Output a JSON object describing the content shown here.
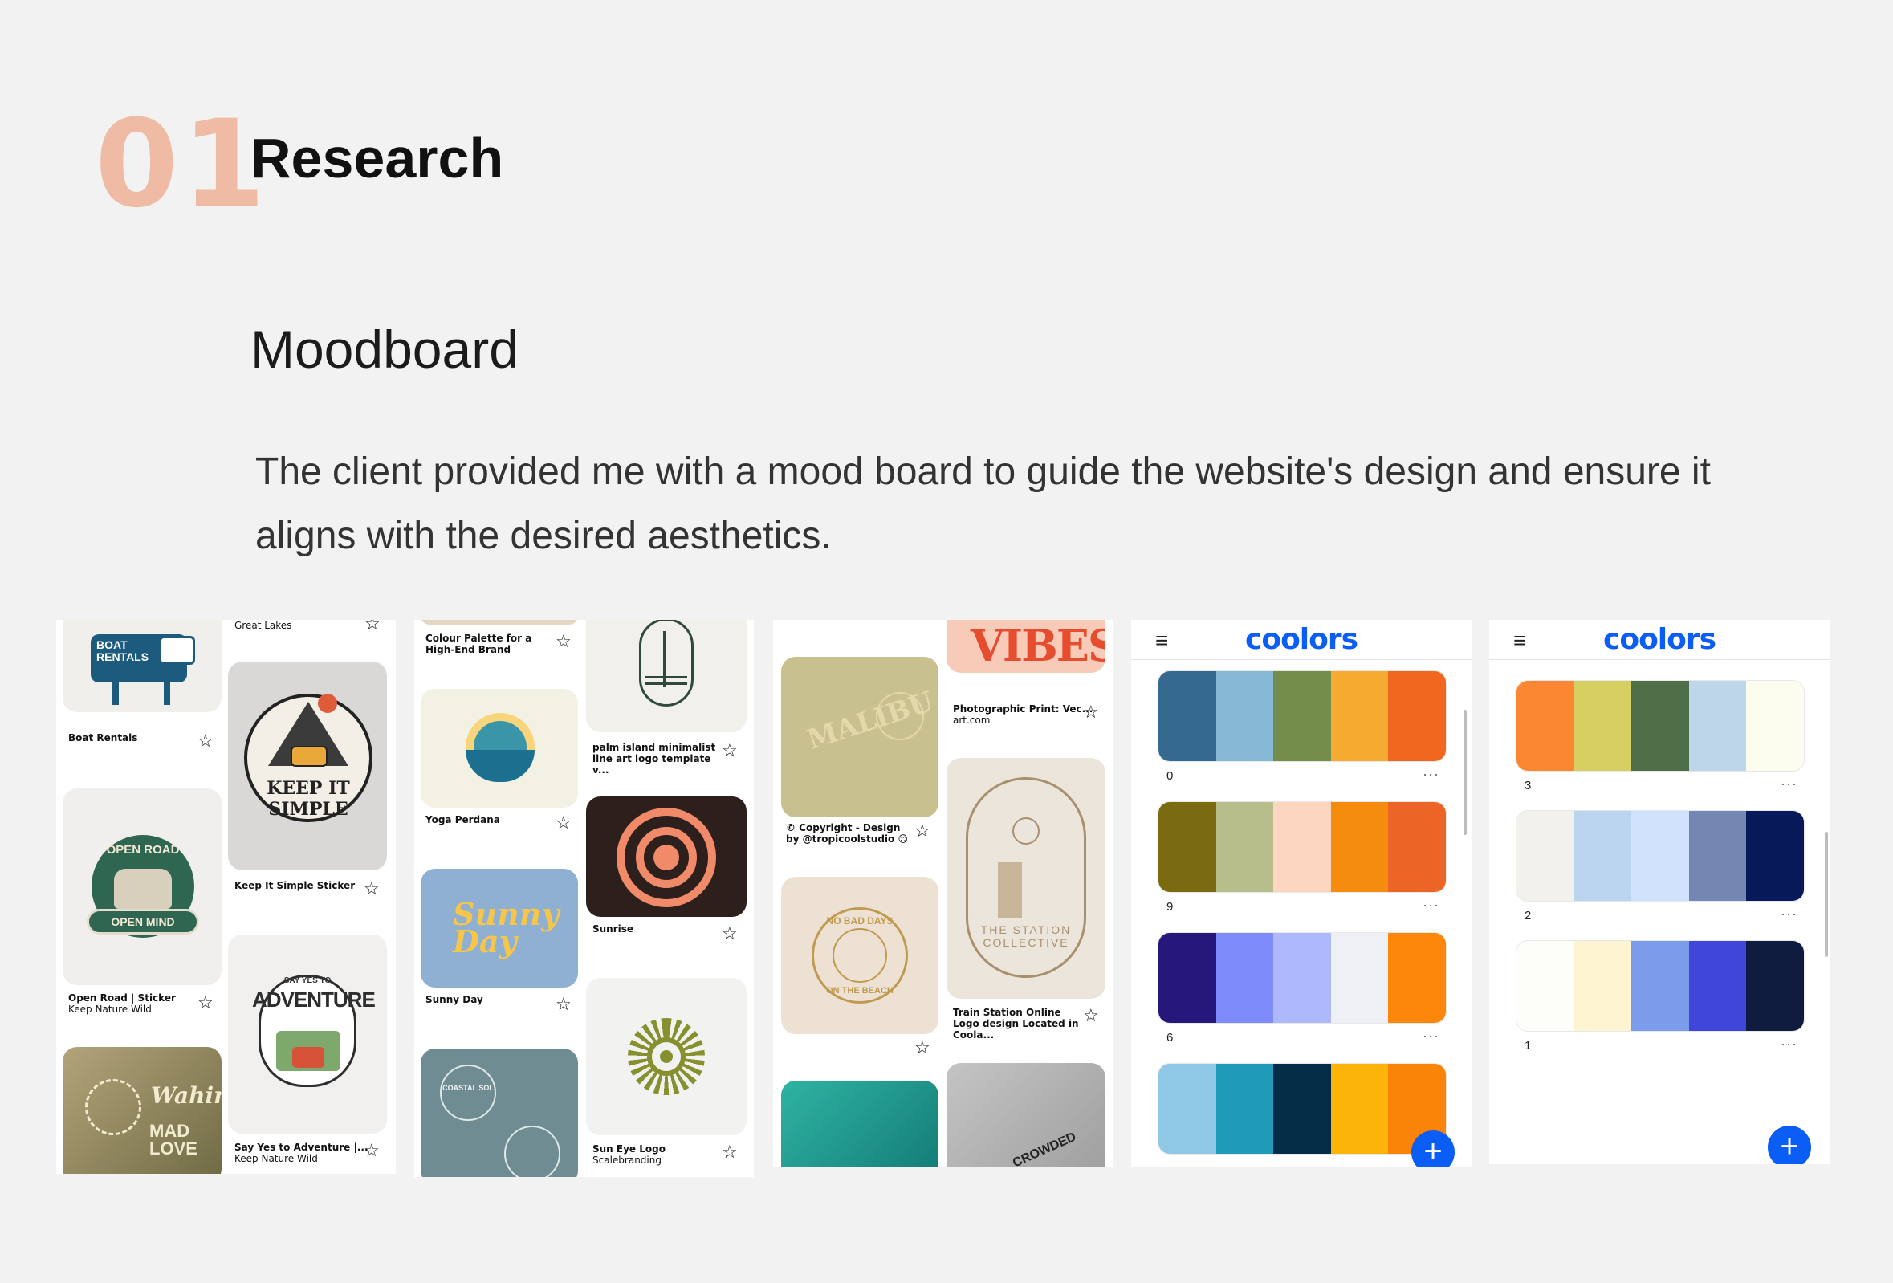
{
  "heading": {
    "number": "01",
    "title": "Research"
  },
  "subheading": "Moodboard",
  "description": "The client provided me with a mood board to guide the website's design and ensure it aligns with the desired aesthetics.",
  "panel1": {
    "top_caption": "Great Lakes",
    "boat_sign_1": "BOAT",
    "boat_sign_2": "RENTALS",
    "c1": "Boat Rentals",
    "c2": "Keep It Simple Sticker",
    "keep_text": "KEEP IT SIMPLE",
    "c3_title": "Open Road | Sticker",
    "c3_sub": "Keep Nature Wild",
    "open_road_top": "OPEN ROAD",
    "open_road_bottom": "OPEN MIND",
    "say_yes": "SAY YES TO",
    "adventure": "ADVENTURE",
    "c4_title": "Say Yes to Adventure |...",
    "c4_sub": "Keep Nature Wild",
    "wahine": "Wahine",
    "mad_love": "MAD LOVE"
  },
  "panel2": {
    "c1": "Colour Palette for a High-End Brand",
    "c2": "palm island minimalist line art logo template v...",
    "c3": "Yoga Perdana",
    "c4": "Sunrise",
    "sunny": "Sunny Day",
    "c5": "Sunny Day",
    "c6_title": "Sun Eye Logo",
    "c6_sub": "Scalebranding",
    "coastal": "COASTAL SOL"
  },
  "panel3": {
    "vibes": "VIBES",
    "c1": "Photographic Print: Vec...",
    "c1_sub": "art.com",
    "malibu": "MALIBU",
    "c2": "© Copyright - Design by @tropicoolstudio 😊",
    "station": "THE STATION COLLECTIVE",
    "c3": "Train Station Online Logo design Located in Coola...",
    "no_bad_days": "NO BAD DAYS",
    "on_the_beach": "ON THE BEACH",
    "crowded": "CROWDED"
  },
  "coolors": {
    "logo": "coolors",
    "menu_icon": "≡",
    "dots": "···",
    "fab": "+"
  },
  "panel4_palettes": [
    {
      "label": "0",
      "colors": [
        "#35698f",
        "#86b9d6",
        "#758d4a",
        "#f4ab30",
        "#f2671f"
      ]
    },
    {
      "label": "9",
      "colors": [
        "#7a6a10",
        "#b8bd8c",
        "#fdd6bf",
        "#f68c0f",
        "#ec6526"
      ]
    },
    {
      "label": "6",
      "colors": [
        "#26177a",
        "#7d8cfa",
        "#adb9fc",
        "#eef0f5",
        "#fc870a"
      ]
    },
    {
      "label": "",
      "colors": [
        "#8fc8e6",
        "#1f9ab9",
        "#062d48",
        "#fdb408",
        "#fa8408"
      ]
    }
  ],
  "panel5_palettes": [
    {
      "label": "3",
      "colors": [
        "#fb8733",
        "#d6cf62",
        "#4e6e48",
        "#bdd6ea",
        "#fcfdee"
      ]
    },
    {
      "label": "2",
      "colors": [
        "#f3f1ec",
        "#bad5ed",
        "#d0e2fc",
        "#7487b2",
        "#08195a"
      ]
    },
    {
      "label": "1",
      "colors": [
        "#fdfdf9",
        "#fdf5d2",
        "#7a9cea",
        "#4146da",
        "#101b40"
      ]
    }
  ]
}
